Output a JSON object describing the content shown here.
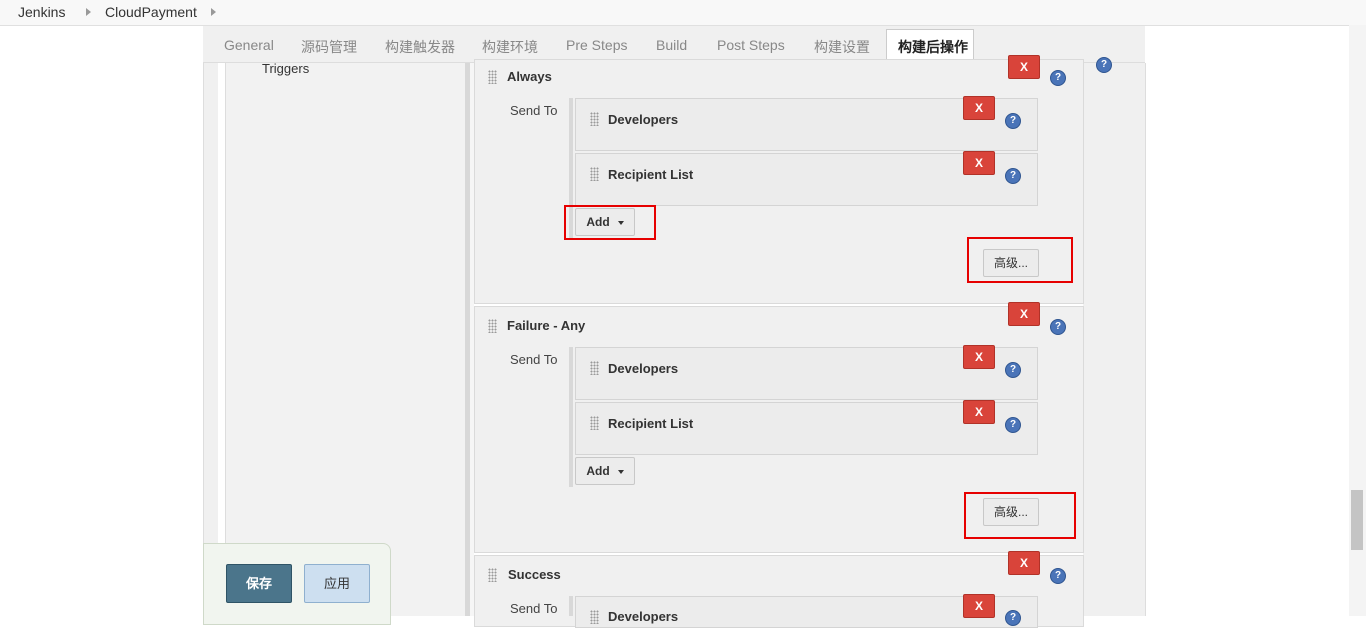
{
  "breadcrumb": {
    "items": [
      "Jenkins",
      "CloudPayment"
    ]
  },
  "tabs": [
    {
      "label": "General",
      "active": false
    },
    {
      "label": "源码管理",
      "active": false
    },
    {
      "label": "构建触发器",
      "active": false
    },
    {
      "label": "构建环境",
      "active": false
    },
    {
      "label": "Pre Steps",
      "active": false
    },
    {
      "label": "Build",
      "active": false
    },
    {
      "label": "Post Steps",
      "active": false
    },
    {
      "label": "构建设置",
      "active": false
    },
    {
      "label": "构建后操作",
      "active": true
    }
  ],
  "left_panel": {
    "label": "Triggers"
  },
  "common": {
    "send_to_label": "Send To",
    "delete_label": "X",
    "help_label": "?",
    "add_label": "Add",
    "advanced_label": "高级..."
  },
  "triggers": [
    {
      "title": "Always",
      "recipients": [
        "Developers",
        "Recipient List"
      ]
    },
    {
      "title": "Failure - Any",
      "recipients": [
        "Developers",
        "Recipient List"
      ]
    },
    {
      "title": "Success",
      "recipients": [
        "Developers"
      ]
    }
  ],
  "bottom_bar": {
    "save_label": "保存",
    "apply_label": "应用"
  },
  "colors": {
    "delete_button": "#d9443a",
    "save_button": "#4b758b",
    "apply_button": "#cddff0",
    "highlight_box": "#e60000",
    "help_icon": "#4a74b8"
  }
}
